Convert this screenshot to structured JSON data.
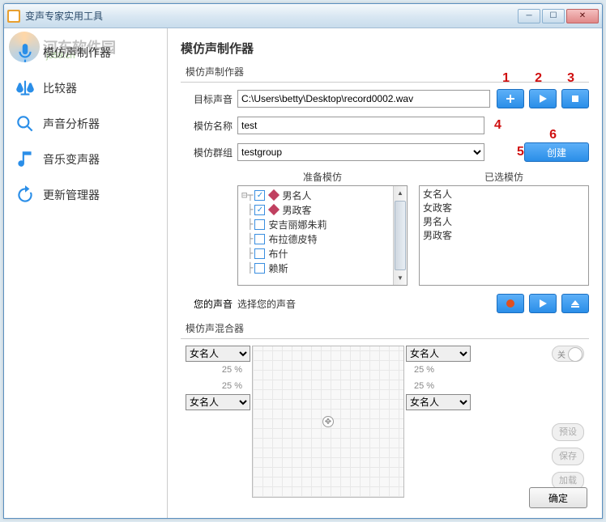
{
  "window": {
    "title": "变声专家实用工具"
  },
  "watermark": {
    "text": "河东软件园",
    "url": "j359.cn"
  },
  "sidebar": {
    "items": [
      {
        "label": "模仿声制作器"
      },
      {
        "label": "比较器"
      },
      {
        "label": "声音分析器"
      },
      {
        "label": "音乐变声器"
      },
      {
        "label": "更新管理器"
      }
    ]
  },
  "main": {
    "title": "模仿声制作器",
    "maker_section": "模仿声制作器",
    "target_voice_label": "目标声音",
    "target_voice_value": "C:\\Users\\betty\\Desktop\\record0002.wav",
    "imitate_name_label": "模仿名称",
    "imitate_name_value": "test",
    "imitate_group_label": "模仿群组",
    "imitate_group_value": "testgroup",
    "create_btn": "创建",
    "prepare_title": "准备模仿",
    "selected_title": "已选模仿",
    "prepare_items": [
      {
        "label": "男名人",
        "checked": true
      },
      {
        "label": "男政客",
        "checked": true
      },
      {
        "label": "安吉丽娜朱莉",
        "checked": false
      },
      {
        "label": "布拉德皮特",
        "checked": false
      },
      {
        "label": "布什",
        "checked": false
      },
      {
        "label": "赖斯",
        "checked": false
      }
    ],
    "selected_items": [
      "女名人",
      "女政客",
      "男名人",
      "男政客"
    ],
    "your_voice_label": "您的声音",
    "your_voice_text": "选择您的声音",
    "mixer_label": "模仿声混合器",
    "mixer_option": "女名人",
    "pct": "25 %",
    "toggle_label": "关",
    "side_btns": [
      "预设",
      "保存",
      "加载"
    ],
    "ok": "确定"
  },
  "annotations": {
    "n1": "1",
    "n2": "2",
    "n3": "3",
    "n4": "4",
    "n5": "5",
    "n6": "6"
  }
}
